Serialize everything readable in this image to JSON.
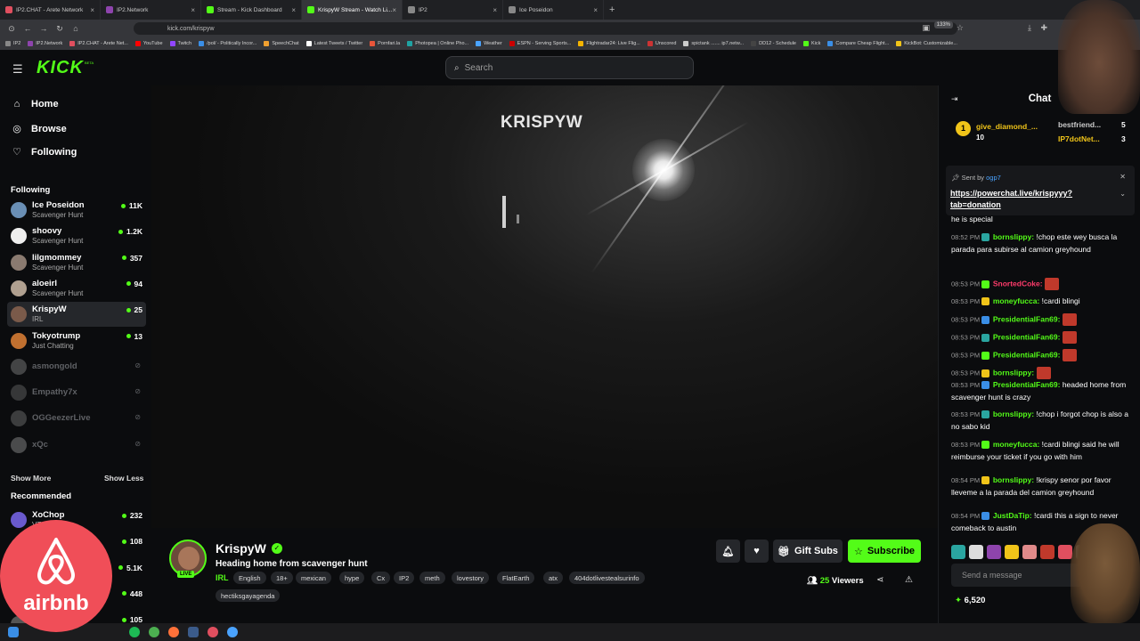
{
  "browser": {
    "tabs": [
      {
        "title": "IP2.CHAT - Arete Network",
        "color": "#e04f5f"
      },
      {
        "title": "IP2.Network",
        "color": "#8e44ad"
      },
      {
        "title": "Stream - Kick Dashboard",
        "color": "#53fc18"
      },
      {
        "title": "KrispyW Stream - Watch Li...",
        "color": "#53fc18"
      },
      {
        "title": "IP2",
        "color": "#888888"
      },
      {
        "title": "Ice Poseidon",
        "color": "#888888"
      }
    ],
    "url": "kick.com/krispyw",
    "zoom": "133%",
    "bookmarks": [
      "IP2",
      "IP2.Network",
      "IP2.CHAT - Arete Net...",
      "YouTube",
      "Twitch",
      "/pol/ - Politically Incor...",
      "SpeechChat",
      "Latest Tweets / Twitter",
      "Pornfari.la",
      "Photopea | Online Pho...",
      "Weather",
      "ESPN - Serving Sports...",
      "Flightradar24: Live Flig...",
      "Unscored",
      "spictank ....... ip7.netw...",
      "DD12 - Schedule",
      "Kick",
      "Compare Cheap Flight...",
      "KickBot: Customizable..."
    ]
  },
  "header": {
    "logo": "KICK",
    "logo_badge": "BETA",
    "search_placeholder": "Search"
  },
  "sidebar": {
    "nav": [
      {
        "label": "Home",
        "icon": "home-icon"
      },
      {
        "label": "Browse",
        "icon": "compass-icon"
      },
      {
        "label": "Following",
        "icon": "heart-icon"
      }
    ],
    "following_title": "Following",
    "following": [
      {
        "name": "Ice Poseidon",
        "category": "Scavenger Hunt",
        "viewers": "11K",
        "live": true,
        "color": "#6a8fb5"
      },
      {
        "name": "shoovy",
        "category": "Scavenger Hunt",
        "viewers": "1.2K",
        "live": true,
        "color": "#eeeeee"
      },
      {
        "name": "lilgmommey",
        "category": "Scavenger Hunt",
        "viewers": "357",
        "live": true,
        "color": "#8a7a70"
      },
      {
        "name": "aloeirl",
        "category": "Scavenger Hunt",
        "viewers": "94",
        "live": true,
        "color": "#b0a090"
      },
      {
        "name": "KrispyW",
        "category": "IRL",
        "viewers": "25",
        "live": true,
        "color": "#7a5a4a",
        "selected": true
      },
      {
        "name": "Tokyotrump",
        "category": "Just Chatting",
        "viewers": "13",
        "live": true,
        "color": "#c07030"
      },
      {
        "name": "asmongold",
        "live": false,
        "color": "#999999"
      },
      {
        "name": "Empathy7x",
        "live": false,
        "color": "#777777"
      },
      {
        "name": "OGGeezerLive",
        "live": false,
        "color": "#888888"
      },
      {
        "name": "xQc",
        "live": false,
        "color": "#aaaaaa"
      }
    ],
    "show_more": "Show More",
    "show_less": "Show Less",
    "recommended_title": "Recommended",
    "recommended": [
      {
        "name": "XoChop",
        "category": "VTubers",
        "viewers": "232",
        "color": "#6a5acd"
      },
      {
        "name": "",
        "category": "",
        "viewers": "108",
        "color": "#555555"
      },
      {
        "name": "",
        "category": "",
        "viewers": "5.1K",
        "color": "#555555"
      },
      {
        "name": "",
        "category": "",
        "viewers": "448",
        "color": "#555555"
      },
      {
        "name": "",
        "category": "",
        "viewers": "105",
        "color": "#555555"
      }
    ]
  },
  "video": {
    "watermark": "KRISPYW"
  },
  "stream": {
    "streamer": "KrispyW",
    "live_badge": "LIVE",
    "title": "Heading home from scavenger hunt",
    "category": "IRL",
    "tags": [
      "English",
      "18+",
      "mexican",
      "hype",
      "Cx",
      "IP2",
      "meth",
      "lovestory",
      "FlatEarth",
      "atx",
      "404dotlivestealsurinfo",
      "hectiksgayagenda"
    ],
    "gift_subs": "Gift Subs",
    "subscribe": "Subscribe",
    "viewers_count": "25",
    "viewers_label": "Viewers"
  },
  "chat": {
    "title": "Chat",
    "leaderboard": [
      {
        "rank": "1",
        "name": "give_diamond_...",
        "count": "10"
      },
      {
        "name": "bestfriend...",
        "count": "5"
      },
      {
        "name": "IP7dotNet...",
        "count": "3"
      }
    ],
    "pinned_label": "Sent by",
    "pinned_user": "ogp7",
    "pinned_link": "https://powerchat.live/krispyyy?tab=donation",
    "prev_fragment": "he is special",
    "messages": [
      {
        "time": "08:52 PM",
        "user": "bornslippy:",
        "color": "#53fc18",
        "text": "!chop este wey busca la parada para subirse al camion greyhound"
      },
      {
        "time": "08:53 PM",
        "user": "SnortedCoke:",
        "color": "#ff3b6b",
        "text": ""
      },
      {
        "time": "08:53 PM",
        "user": "moneyfucca:",
        "color": "#53fc18",
        "text": "!cardi blingi"
      },
      {
        "time": "08:53 PM",
        "user": "PresidentialFan69:",
        "color": "#53fc18",
        "text": ""
      },
      {
        "time": "08:53 PM",
        "user": "PresidentialFan69:",
        "color": "#53fc18",
        "text": ""
      },
      {
        "time": "08:53 PM",
        "user": "PresidentialFan69:",
        "color": "#53fc18",
        "text": ""
      },
      {
        "time": "08:53 PM",
        "user": "bornslippy:",
        "color": "#53fc18",
        "text": ""
      },
      {
        "time": "08:53 PM",
        "user": "PresidentialFan69:",
        "color": "#53fc18",
        "text": "headed home from scavenger hunt is crazy"
      },
      {
        "time": "08:53 PM",
        "user": "bornslippy:",
        "color": "#53fc18",
        "text": "!chop i forgot chop is also a no sabo kid"
      },
      {
        "time": "08:53 PM",
        "user": "moneyfucca:",
        "color": "#53fc18",
        "text": "!cardi blingi said he will reimburse your ticket if you go with him"
      },
      {
        "time": "08:54 PM",
        "user": "bornslippy:",
        "color": "#53fc18",
        "text": "!krispy senor por favor lleveme a la parada del camion greyhound"
      },
      {
        "time": "08:54 PM",
        "user": "JustDaTip:",
        "color": "#53fc18",
        "text": "!cardi this a sign to never comeback to austin"
      }
    ],
    "input_placeholder": "Send a message",
    "points": "6,520"
  },
  "overlay": {
    "airbnb": "airbnb"
  }
}
